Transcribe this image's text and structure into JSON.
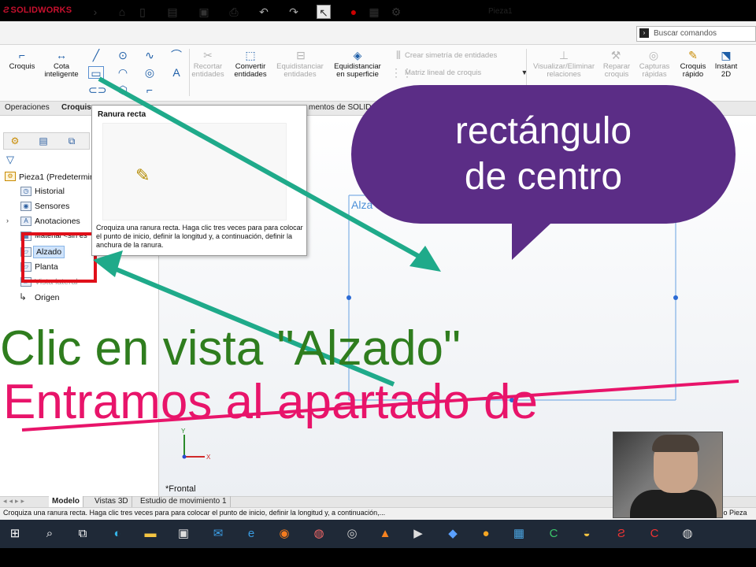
{
  "app": {
    "brand": "SOLIDWORKS",
    "document_title": "Pieza1",
    "search_placeholder": "Buscar comandos"
  },
  "command_manager": {
    "items": [
      {
        "label": "Croquis",
        "icon": "sketch-icon",
        "enabled": true
      },
      {
        "label": "Cota inteligente",
        "icon": "smart-dimension-icon",
        "enabled": true
      },
      {
        "label": "Recortar entidades",
        "icon": "trim-icon",
        "enabled": false
      },
      {
        "label": "Convertir entidades",
        "icon": "convert-icon",
        "enabled": true
      },
      {
        "label": "Equidistanciar entidades",
        "icon": "offset-icon",
        "enabled": false
      },
      {
        "label": "Equidistanciar en superficie",
        "icon": "offset-surface-icon",
        "enabled": true
      },
      {
        "label": "Crear simetría de entidades",
        "icon": "mirror-icon",
        "enabled": false
      },
      {
        "label": "Matriz lineal de croquis",
        "icon": "linear-pattern-icon",
        "enabled": false
      },
      {
        "label": "Visualizar/Eliminar relaciones",
        "icon": "relations-icon",
        "enabled": false
      },
      {
        "label": "Reparar croquis",
        "icon": "repair-icon",
        "enabled": false
      },
      {
        "label": "Capturas rápidas",
        "icon": "quick-snaps-icon",
        "enabled": false
      },
      {
        "label": "Croquis rápido",
        "icon": "rapid-sketch-icon",
        "enabled": true
      },
      {
        "label": "Instant 2D",
        "icon": "instant2d-icon",
        "enabled": true
      }
    ]
  },
  "tabs": [
    {
      "label": "Operaciones",
      "active": false
    },
    {
      "label": "Croquis",
      "active": true
    },
    {
      "label": "mentos de SOLID",
      "active": false
    }
  ],
  "feature_tree": {
    "root": "Pieza1 (Predetermin",
    "items": [
      {
        "label": "Historial",
        "icon": "history-icon"
      },
      {
        "label": "Sensores",
        "icon": "sensor-icon"
      },
      {
        "label": "Anotaciones",
        "icon": "annotation-icon"
      },
      {
        "label": "Material <sin es",
        "icon": "material-icon"
      },
      {
        "label": "Alzado",
        "icon": "plane-icon",
        "highlighted": true
      },
      {
        "label": "Planta",
        "icon": "plane-icon"
      },
      {
        "label": "Vista lateral",
        "icon": "plane-icon"
      },
      {
        "label": "Origen",
        "icon": "origin-icon"
      }
    ]
  },
  "tooltip": {
    "title": "Ranura recta",
    "description": "Croquiza una ranura recta. Haga clic tres veces para para colocar el punto de inicio, definir la longitud y, a continuación, definir la anchura de la ranura."
  },
  "graphics": {
    "view_label": "*Frontal",
    "sketch_label": "Alza"
  },
  "bottom_tabs": [
    {
      "label": "Modelo",
      "active": true
    },
    {
      "label": "Vistas 3D",
      "active": false
    },
    {
      "label": "Estudio de movimiento 1",
      "active": false
    }
  ],
  "status": {
    "text": "Croquiza una ranura recta. Haga clic tres veces para para colocar el punto de inicio, definir la longitud y, a continuación,...",
    "mode": "Editando Pieza"
  },
  "overlay": {
    "bubble_line1": "rectángulo",
    "bubble_line2": "de centro",
    "caption_green": "Clic en vista \"Alzado\"",
    "caption_pink": "Entramos al apartado de",
    "colors": {
      "bubble": "#5b2d86",
      "arrow": "#1faa8a",
      "highlight_box": "#e0101a",
      "caption_green": "#2f7d1e",
      "caption_pink": "#e8146a"
    }
  },
  "taskbar": {
    "items": [
      "windows-icon",
      "search-icon",
      "task-view-icon",
      "edge-icon",
      "explorer-icon",
      "store-icon",
      "mail-icon",
      "ie-icon",
      "firefox-icon",
      "paint-icon",
      "chrome-icon",
      "vlc-icon",
      "media-icon",
      "app-icon",
      "app-icon",
      "photos-icon",
      "camtasia-icon",
      "app-icon",
      "solidworks-icon",
      "app-icon",
      "app-icon"
    ]
  }
}
